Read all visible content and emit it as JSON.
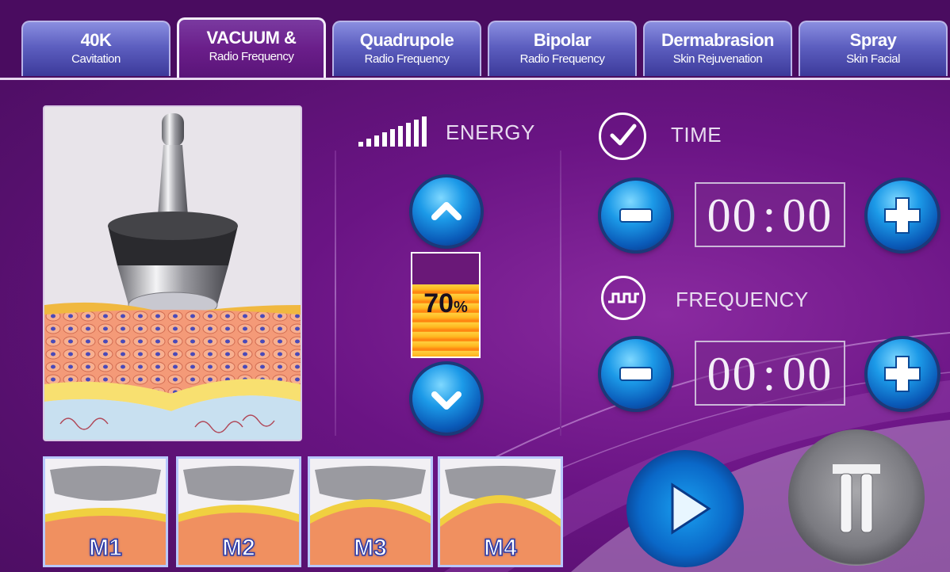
{
  "tabs": [
    {
      "title": "40K",
      "subtitle": "Cavitation"
    },
    {
      "title": "VACUUM &",
      "subtitle": "Radio Frequency"
    },
    {
      "title": "Quadrupole",
      "subtitle": "Radio Frequency"
    },
    {
      "title": "Bipolar",
      "subtitle": "Radio Frequency"
    },
    {
      "title": "Dermabrasion",
      "subtitle": "Skin Rejuvenation"
    },
    {
      "title": "Spray",
      "subtitle": "Skin Facial"
    }
  ],
  "active_tab": "VACUUM &",
  "energy": {
    "label": "ENERGY",
    "value_text": "70",
    "unit": "%",
    "level": 0.7
  },
  "time": {
    "label": "TIME",
    "value": "00:00",
    "hh": "00",
    "sep": ":",
    "mm": "00"
  },
  "frequency": {
    "label": "FREQUENCY",
    "value": "00:00",
    "hh": "00",
    "sep": ":",
    "mm": "00"
  },
  "modes": [
    "M1",
    "M2",
    "M3",
    "M4"
  ],
  "icons": {
    "energy": "signal-bars-icon",
    "time": "check-circle-icon",
    "frequency": "square-wave-icon",
    "up": "chevron-up-icon",
    "down": "chevron-down-icon",
    "minus": "minus-icon",
    "plus": "plus-icon",
    "start": "play-icon",
    "pause": "pause-icon"
  },
  "colors": {
    "background": "#5a1070",
    "tab": "#5d5fc0",
    "tab_active": "#6a1e8a",
    "button_blue": "#1c9ae8",
    "meter": "#ffb820"
  }
}
